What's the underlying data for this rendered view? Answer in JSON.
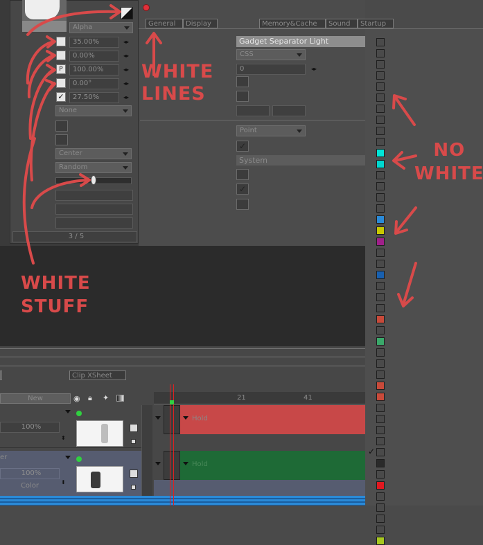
{
  "left_panel": {
    "alpha_dropdown": "Alpha",
    "fields": [
      "35.00%",
      "0.00%",
      "100.00%",
      "0.00°",
      "27.50%"
    ],
    "p_label": "P",
    "none_dropdown": "None",
    "center_dropdown": "Center",
    "random_dropdown": "Random",
    "page_indicator": "3 / 5"
  },
  "prefs": {
    "tabs_left": [
      "General",
      "Display"
    ],
    "tabs_right": [
      "Memory&Cache",
      "Sound",
      "Startup"
    ],
    "gadget_header": "Gadget Separator Light",
    "css_dropdown": "CSS",
    "zero_field": "0",
    "point_dropdown": "Point",
    "system_header": "System"
  },
  "timeline": {
    "clip_xsheet": "Clip XSheet",
    "new_label": "New",
    "frame_21": "21",
    "frame_41": "41",
    "row1_opacity": "100%",
    "row2_opacity": "100%",
    "row2_prefix": "er",
    "color_label": "Color",
    "hold_label_1": "Hold",
    "hold_label_2": "Hold"
  },
  "annotations": {
    "white_lines": "WHITE\nLINES",
    "white_stuff": "WHITE\nSTUFF",
    "no_white": "NO\nWHITE"
  },
  "palette": [
    "#4a4a4a",
    "#4a4a4a",
    "#4a4a4a",
    "#4a4a4a",
    "#4a4a4a",
    "#4a4a4a",
    "#4a4a4a",
    "#4a4a4a",
    "#4a4a4a",
    "#4a4a4a",
    "#00e5d8",
    "#00d8d0",
    "#4a4a4a",
    "#4a4a4a",
    "#4a4a4a",
    "#4a4a4a",
    "#2a8ad8",
    "#c8c800",
    "#a0208a",
    "#4a4a4a",
    "#4a4a4a",
    "#1860b0",
    "#4a4a4a",
    "#4a4a4a",
    "#4a4a4a",
    "#c84a3a",
    "#4a4a4a",
    "#3aa86a",
    "#4a4a4a",
    "#4a4a4a",
    "#4a4a4a",
    "#c84a3a",
    "#c84a3a",
    "#4a4a4a",
    "#4a4a4a",
    "#4a4a4a",
    "#4a4a4a",
    "#4a4a4a",
    "#2a2a2a",
    "#4a4a4a",
    "#e01820",
    "#4a4a4a",
    "#4a4a4a",
    "#4a4a4a",
    "#4a4a4a",
    "#a8c820"
  ],
  "colors": {
    "hold_red": "#c84848",
    "hold_green": "#1e6a36",
    "annotation_red": "#d84a4a"
  }
}
